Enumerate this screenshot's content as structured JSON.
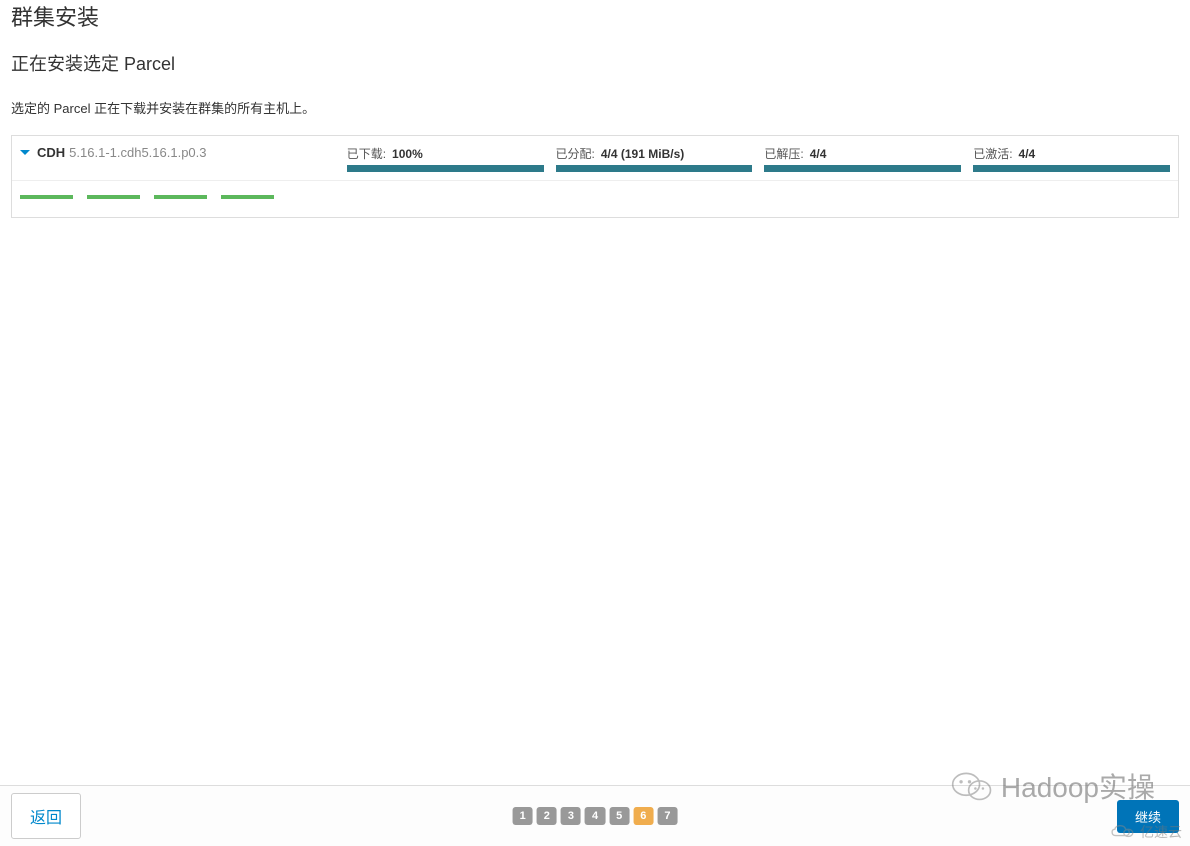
{
  "page": {
    "title": "群集安装",
    "subtitle": "正在安装选定 Parcel",
    "description": "选定的 Parcel 正在下载并安装在群集的所有主机上。"
  },
  "parcel": {
    "name": "CDH",
    "version": "5.16.1-1.cdh5.16.1.p0.3",
    "downloaded": {
      "label": "已下载:",
      "value": "100%"
    },
    "distributed": {
      "label": "已分配:",
      "value": "4/4 (191 MiB/s)"
    },
    "unpacked": {
      "label": "已解压:",
      "value": "4/4"
    },
    "activated": {
      "label": "已激活:",
      "value": "4/4"
    }
  },
  "footer": {
    "back_label": "返回",
    "continue_label": "继续",
    "pages": [
      "1",
      "2",
      "3",
      "4",
      "5",
      "6",
      "7"
    ],
    "active_page": "6"
  },
  "watermark": {
    "text": "Hadoop实操",
    "cloud_text": "亿速云"
  }
}
